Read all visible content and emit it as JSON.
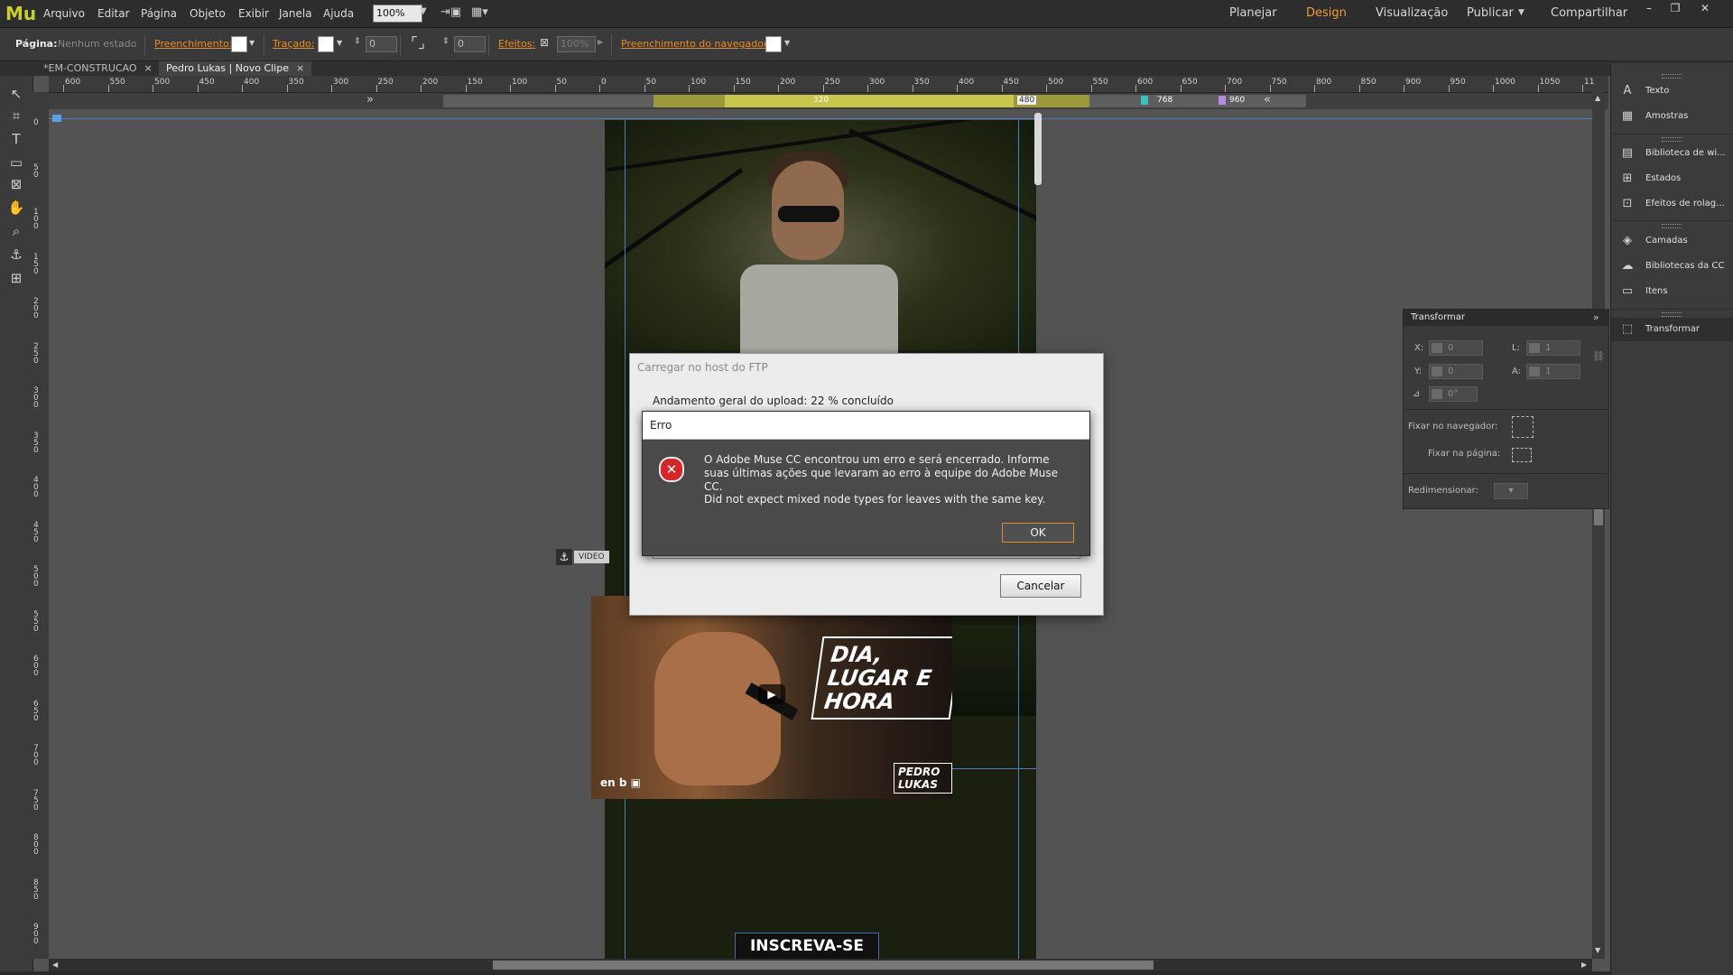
{
  "app": {
    "logo": "Mu"
  },
  "menu": [
    "Arquivo",
    "Editar",
    "Página",
    "Objeto",
    "Exibir",
    "Janela",
    "Ajuda"
  ],
  "zoom": "100%",
  "modes": {
    "plan": "Planejar",
    "design": "Design",
    "preview": "Visualização",
    "publish": "Publicar",
    "share": "Compartilhar"
  },
  "window_buttons": {
    "minimize": "–",
    "restore": "❐",
    "close": "✕"
  },
  "controlbar": {
    "page_label": "Página:",
    "page_state": "Nenhum estado",
    "fill_label": "Preenchimento:",
    "stroke_label": "Traçado:",
    "stroke_value": "0",
    "corner_value": "0",
    "effects_label": "Efeitos:",
    "effects_value": "100%",
    "browser_fill_label": "Preenchimento do navegador:"
  },
  "tabs": [
    {
      "label": "*EM-CONSTRUCAO",
      "close": "×"
    },
    {
      "label": "Pedro Lukas | Novo Clipe",
      "close": "×"
    }
  ],
  "ruler": {
    "h_ticks": [
      "600",
      "550",
      "500",
      "450",
      "400",
      "350",
      "300",
      "250",
      "200",
      "150",
      "100",
      "50",
      "0",
      "50",
      "100",
      "150",
      "200",
      "250",
      "300",
      "350",
      "400",
      "450",
      "500",
      "550",
      "600",
      "650",
      "700",
      "750",
      "800",
      "850",
      "900",
      "950",
      "1000",
      "1050",
      "11"
    ],
    "v_ticks": [
      "0",
      "50",
      "100",
      "150",
      "200",
      "250",
      "300",
      "350",
      "400",
      "450",
      "500",
      "550",
      "600",
      "650",
      "700",
      "750",
      "800",
      "850",
      "900"
    ]
  },
  "breakpoints": {
    "b320": "320",
    "b480": "480",
    "b768": "768",
    "b960": "960"
  },
  "canvas": {
    "video_anchor_icon": "⚓",
    "video_tag": "VIDEO",
    "thumb_title": "DIA, LUGAR E HORA",
    "thumb_logos": "en  b  ▣",
    "thumb_signature": "PEDRO LUKAS",
    "play_icon": "▶",
    "subscribe": "INSCREVA-SE"
  },
  "right_panels": [
    {
      "icon": "text-icon",
      "glyph": "A",
      "label": "Texto"
    },
    {
      "icon": "swatches-icon",
      "glyph": "▦",
      "label": "Amostras"
    },
    {
      "icon": "widgets-library-icon",
      "glyph": "▤",
      "label": "Biblioteca de wi..."
    },
    {
      "icon": "states-icon",
      "glyph": "⊞",
      "label": "Estados"
    },
    {
      "icon": "scroll-effects-icon",
      "glyph": "⊡",
      "label": "Efeitos de rolag..."
    },
    {
      "icon": "layers-icon",
      "glyph": "◈",
      "label": "Camadas"
    },
    {
      "icon": "cc-libraries-icon",
      "glyph": "☁",
      "label": "Bibliotecas da CC"
    },
    {
      "icon": "assets-icon",
      "glyph": "▭",
      "label": "Itens"
    },
    {
      "icon": "transform-icon",
      "glyph": "⬚",
      "label": "Transformar"
    }
  ],
  "transform_panel": {
    "title": "Transformar",
    "collapse": "»",
    "x_label": "X:",
    "x_value": "0",
    "y_label": "Y:",
    "y_value": "0",
    "w_label": "L:",
    "w_value": "1",
    "h_label": "A:",
    "h_value": "1",
    "angle_label": "⊿",
    "angle_value": "0°",
    "pin_browser_label": "Fixar no navegador:",
    "pin_page_label": "Fixar na página:",
    "resize_label": "Redimensionar:",
    "resize_value": "▾"
  },
  "ftp_dialog": {
    "title": "Carregar no host do FTP",
    "progress": "Andamento geral do upload: 22 % concluído",
    "cancel": "Cancelar"
  },
  "error_dialog": {
    "title": "Erro",
    "icon": "✕",
    "message": "O Adobe Muse CC encontrou um erro e será encerrado. Informe suas últimas ações que levaram ao erro à equipe do Adobe Muse CC.",
    "detail": "Did not expect mixed node types for leaves with the same key.",
    "ok": "OK"
  }
}
